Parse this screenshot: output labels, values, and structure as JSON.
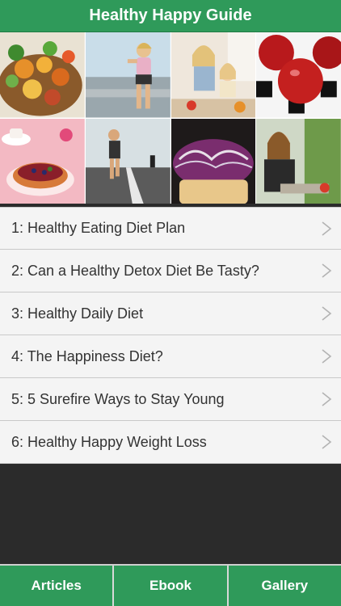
{
  "header": {
    "title": "Healthy Happy Guide"
  },
  "banner": {
    "tiles": [
      "salad-photo",
      "runner-woman-photo",
      "mother-daughter-kitchen-photo",
      "red-apples-photo",
      "tea-and-tart-photo",
      "runners-road-photo",
      "sprouts-bowl-photo",
      "woman-thinking-photo"
    ]
  },
  "articles": {
    "items": [
      {
        "label": "1: Healthy Eating Diet Plan"
      },
      {
        "label": "2: Can a Healthy Detox Diet Be Tasty?"
      },
      {
        "label": "3: Healthy Daily Diet"
      },
      {
        "label": "4: The Happiness Diet?"
      },
      {
        "label": "5: 5 Surefire Ways to Stay Young"
      },
      {
        "label": "6: Healthy Happy Weight Loss"
      }
    ],
    "chevron_icon": "chevron-right-icon"
  },
  "tabbar": {
    "tabs": [
      {
        "label": "Articles"
      },
      {
        "label": "Ebook"
      },
      {
        "label": "Gallery"
      }
    ]
  },
  "colors": {
    "accent": "#2f9a5a",
    "background": "#2b2b2b",
    "row": "#f4f4f4"
  }
}
